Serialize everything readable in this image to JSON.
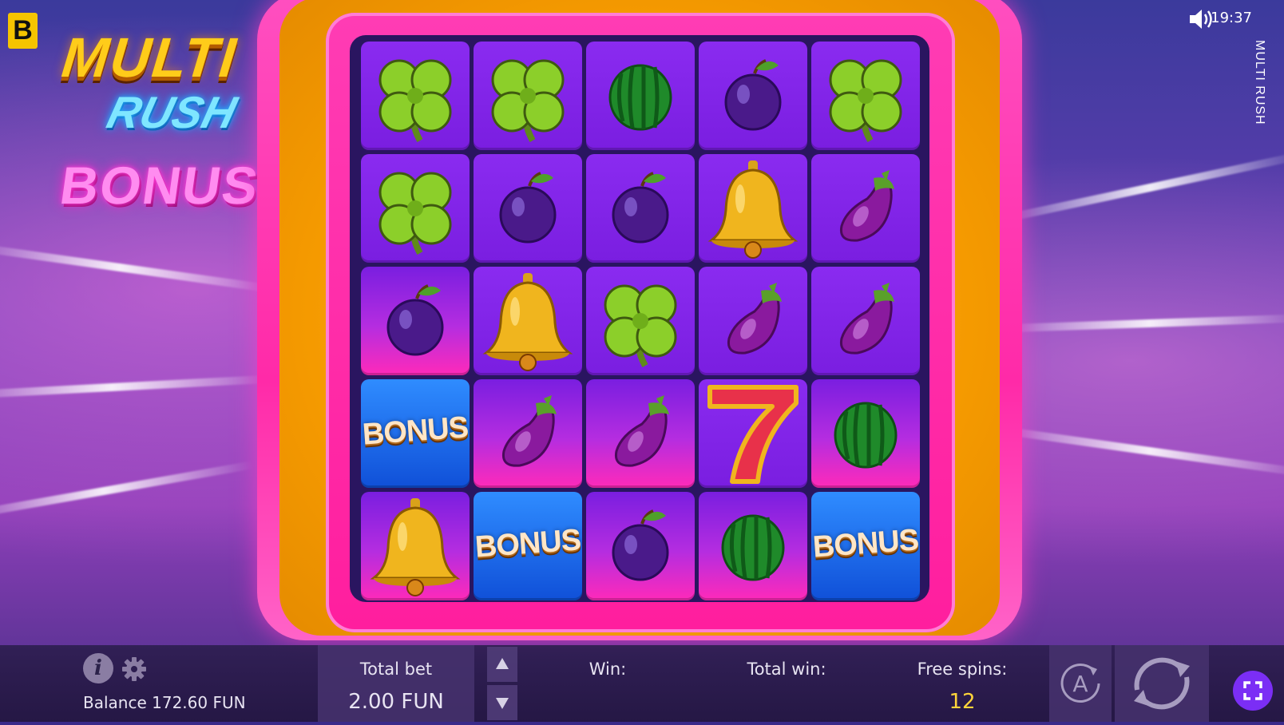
{
  "header": {
    "brand_letter": "B",
    "clock": "19:37",
    "vertical_title": "MULTI RUSH"
  },
  "logo": {
    "line1": "MULTI",
    "line2": "RUSH",
    "line3": "BONUS"
  },
  "grid": {
    "rows": [
      [
        "clover",
        "clover",
        "watermelon",
        "plum",
        "clover"
      ],
      [
        "clover",
        "plum",
        "plum",
        "bell",
        "eggplant"
      ],
      [
        "plum",
        "bell",
        "clover",
        "eggplant",
        "eggplant"
      ],
      [
        "bonus",
        "eggplant",
        "eggplant",
        "seven",
        "watermelon"
      ],
      [
        "bell",
        "bonus",
        "plum",
        "watermelon",
        "bonus"
      ]
    ],
    "highlighted": [
      [
        2,
        0
      ],
      [
        3,
        1
      ],
      [
        3,
        2
      ],
      [
        3,
        4
      ],
      [
        4,
        0
      ],
      [
        4,
        2
      ],
      [
        4,
        3
      ]
    ],
    "bonus_label": "BONUS"
  },
  "bottom_bar": {
    "balance_label": "Balance 172.60 FUN",
    "total_bet_label": "Total bet",
    "total_bet_value": "2.00 FUN",
    "win_label": "Win:",
    "total_win_label": "Total win:",
    "free_spins_label": "Free spins:",
    "free_spins_value": "12",
    "autoplay_letter": "A"
  },
  "colors": {
    "accent_purple": "#7b2ef5",
    "free_spins_value": "#ffd43a",
    "frame_pink": "#ff2aa8",
    "frame_gold": "#f59a00"
  }
}
